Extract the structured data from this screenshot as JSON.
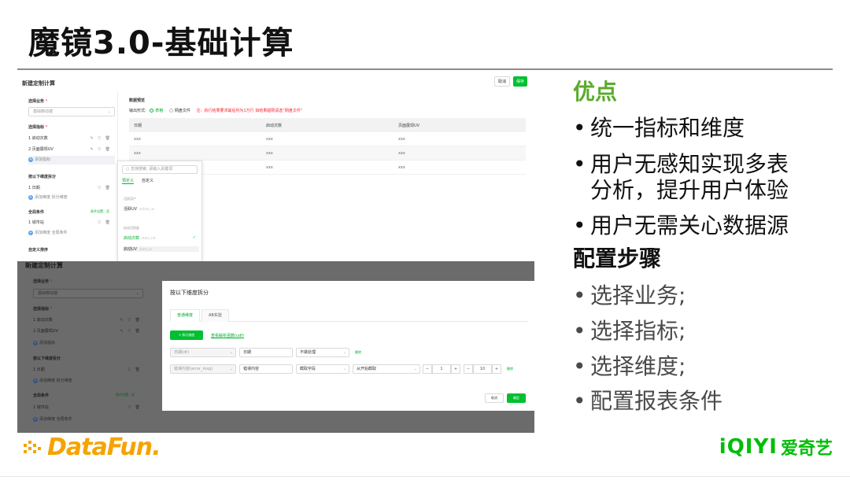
{
  "slide": {
    "title": "魔镜3.0-基础计算"
  },
  "top_shot": {
    "title": "新建定制计算",
    "cancel": "取消",
    "save": "保存",
    "left": {
      "business_label": "选择业务",
      "business_value": "基础移动端",
      "metrics_label": "选择指标",
      "metrics": [
        {
          "label": "1 启动次数"
        },
        {
          "label": "2 页面展现UV"
        }
      ],
      "add_metric": "添加指标",
      "dimension_label": "按以下维度拆分",
      "dimensions": [
        {
          "label": "1 日期"
        }
      ],
      "add_dimension": "添加维度 拆分维度",
      "global_label": "全局条件",
      "global_link": "条件设置：",
      "global_link_flag": "否",
      "global_items": [
        {
          "label": "1 城市站"
        }
      ],
      "add_global": "添加维度 全局条件",
      "custom_label": "自定义排序"
    },
    "data": {
      "title": "数据预览",
      "output_label": "输出形式:",
      "option_table": "表格",
      "option_file": "网盘文件",
      "warning": "注：执行结果要求最后列为1万行 如结果超限请选“网盘文件”",
      "columns": [
        "日期",
        "启动次数",
        "页面展现UV"
      ],
      "rows": [
        [
          "xxx",
          "xxx",
          "xxx"
        ],
        [
          "xxx",
          "xxx",
          "xxx"
        ],
        [
          "xxx",
          "xxx",
          "xxx"
        ]
      ]
    },
    "dropdown": {
      "search_placeholder": "支持搜索, 请输入关键词",
      "tab_predefined": "预定义",
      "tab_custom": "自定义",
      "section_user": "活跃用户",
      "opt_active_uv": "活跃UV",
      "opt_active_uv_id": "active_uv",
      "section_device": "启动活跃度",
      "opt_launch": "启动次数",
      "opt_launch_id": "start_cnt",
      "opt_launch_uv": "启动UV",
      "opt_launch_uv_id": "start_uv"
    }
  },
  "bottom_shot": {
    "title": "新建定制计算",
    "left": {
      "business_label": "选择业务",
      "business_value": "基础移动端",
      "metrics_label": "选择指标",
      "metrics": [
        {
          "label": "1 启动次数"
        },
        {
          "label": "2 页面展现UV"
        }
      ],
      "add_metric": "添加指标",
      "dimension_label": "按以下维度拆分",
      "dimensions": [
        {
          "label": "1 日期"
        }
      ],
      "add_dimension": "添加维度 拆分维度",
      "global_label": "全局条件",
      "global_link": "条件设置：",
      "global_link_flag": "否",
      "global_items": [
        {
          "label": "1 城市站"
        }
      ],
      "add_global": "添加维度 全局条件"
    },
    "modal": {
      "title": "按以下维度拆分",
      "tab_normal": "普通维度",
      "tab_ab": "AB实验",
      "split_button": "+ 拆分维度",
      "help_link": "查看解析函数(udf)",
      "row1": {
        "field": "日期(dt)",
        "name": "日期",
        "process": "不做处理",
        "delete": "删除"
      },
      "row2": {
        "field": "错误内容(error_msg)",
        "name": "错误内容",
        "process": "截取字段",
        "mode": "从开始截取",
        "from": "1",
        "to": "10",
        "delete": "删除"
      },
      "cancel": "取消",
      "ok": "确定"
    }
  },
  "right": {
    "pros_heading": "优点",
    "pros_color": "#5aab2a",
    "pros": [
      "统一指标和维度",
      "用户无感知实现多表",
      "分析，提升用户体验",
      "用户无需关心数据源"
    ],
    "steps_heading": "配置步骤",
    "steps": [
      "选择业务;",
      "选择指标;",
      "选择维度;",
      "配置报表条件"
    ]
  },
  "footer": {
    "datafun": "DataFun.",
    "iqiyi_en": "iQIYI",
    "iqiyi_cn": "爱奇艺"
  }
}
